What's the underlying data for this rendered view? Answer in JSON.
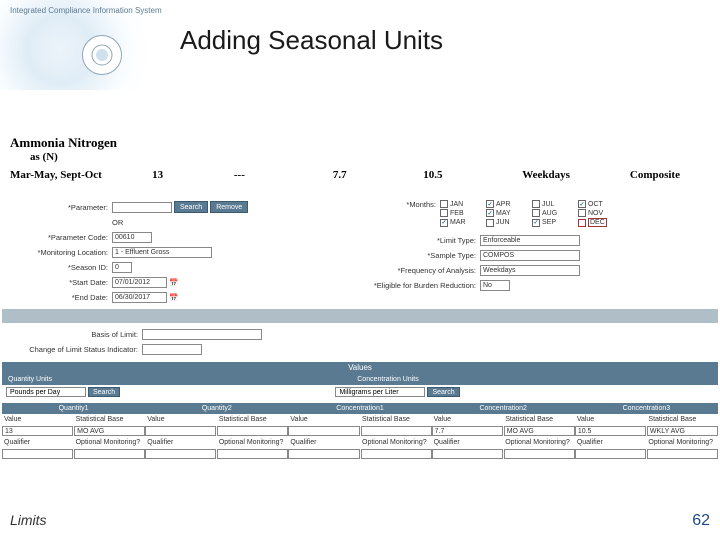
{
  "header": {
    "integrated_text": "Integrated Compliance Information System",
    "title": "Adding Seasonal Units"
  },
  "param": {
    "name": "Ammonia Nitrogen",
    "sub": "as (N)",
    "period": "Mar-May, Sept-Oct",
    "v1": "13",
    "v2": "---",
    "v3": "7.7",
    "v4": "10.5",
    "v5": "Weekdays",
    "v6": "Composite"
  },
  "form": {
    "parameter_label": "Parameter:",
    "search_btn": "Search",
    "remove_btn": "Remove",
    "or_text": "OR",
    "param_code_label": "Parameter Code:",
    "param_code": "00610",
    "mon_loc_label": "Monitoring Location:",
    "mon_loc": "1 - Effluent Gross",
    "season_label": "Season ID:",
    "season": "0",
    "start_date_label": "Start Date:",
    "start_date": "07/01/2012",
    "end_date_label": "End Date:",
    "end_date": "06/30/2017",
    "months_label": "Months:",
    "months": {
      "JAN": false,
      "APR": true,
      "JUL": false,
      "OCT": true,
      "FEB": false,
      "MAY": true,
      "AUG": false,
      "NOV": false,
      "MAR": true,
      "JUN": false,
      "SEP": true,
      "DEC": false
    },
    "limit_type_label": "Limit Type:",
    "limit_type": "Enforceable",
    "sample_type_label": "Sample Type:",
    "sample_type": "COMPOS",
    "freq_label": "Frequency of Analysis:",
    "freq": "Weekdays",
    "burden_label": "Eligible for Burden Reduction:",
    "burden": "No",
    "basis_label": "Basis of Limit:",
    "change_status_label": "Change of Limit Status Indicator:"
  },
  "values": {
    "values_header": "Values",
    "qty_units_label": "Quantity Units",
    "qty_units": "Pounds per Day",
    "conc_units_label": "Concentration Units",
    "conc_units": "Milligrams per Liter",
    "search_btn": "Search",
    "cols": {
      "q1": "Quantity1",
      "q2": "Quantity2",
      "c1": "Concentration1",
      "c2": "Concentration2",
      "c3": "Concentration3"
    },
    "sub": {
      "value": "Value",
      "stat_base": "Statistical Base",
      "qualifier": "Qualifier",
      "opt_mon": "Optional Monitoring?"
    },
    "data": {
      "q1_val": "13",
      "q1_stat": "MO AVG",
      "c2_val": "7.7",
      "c2_stat": "MO AVG",
      "c3_val": "10.5",
      "c3_stat": "WKLY AVG"
    }
  },
  "footer": {
    "label": "Limits",
    "page": "62"
  }
}
